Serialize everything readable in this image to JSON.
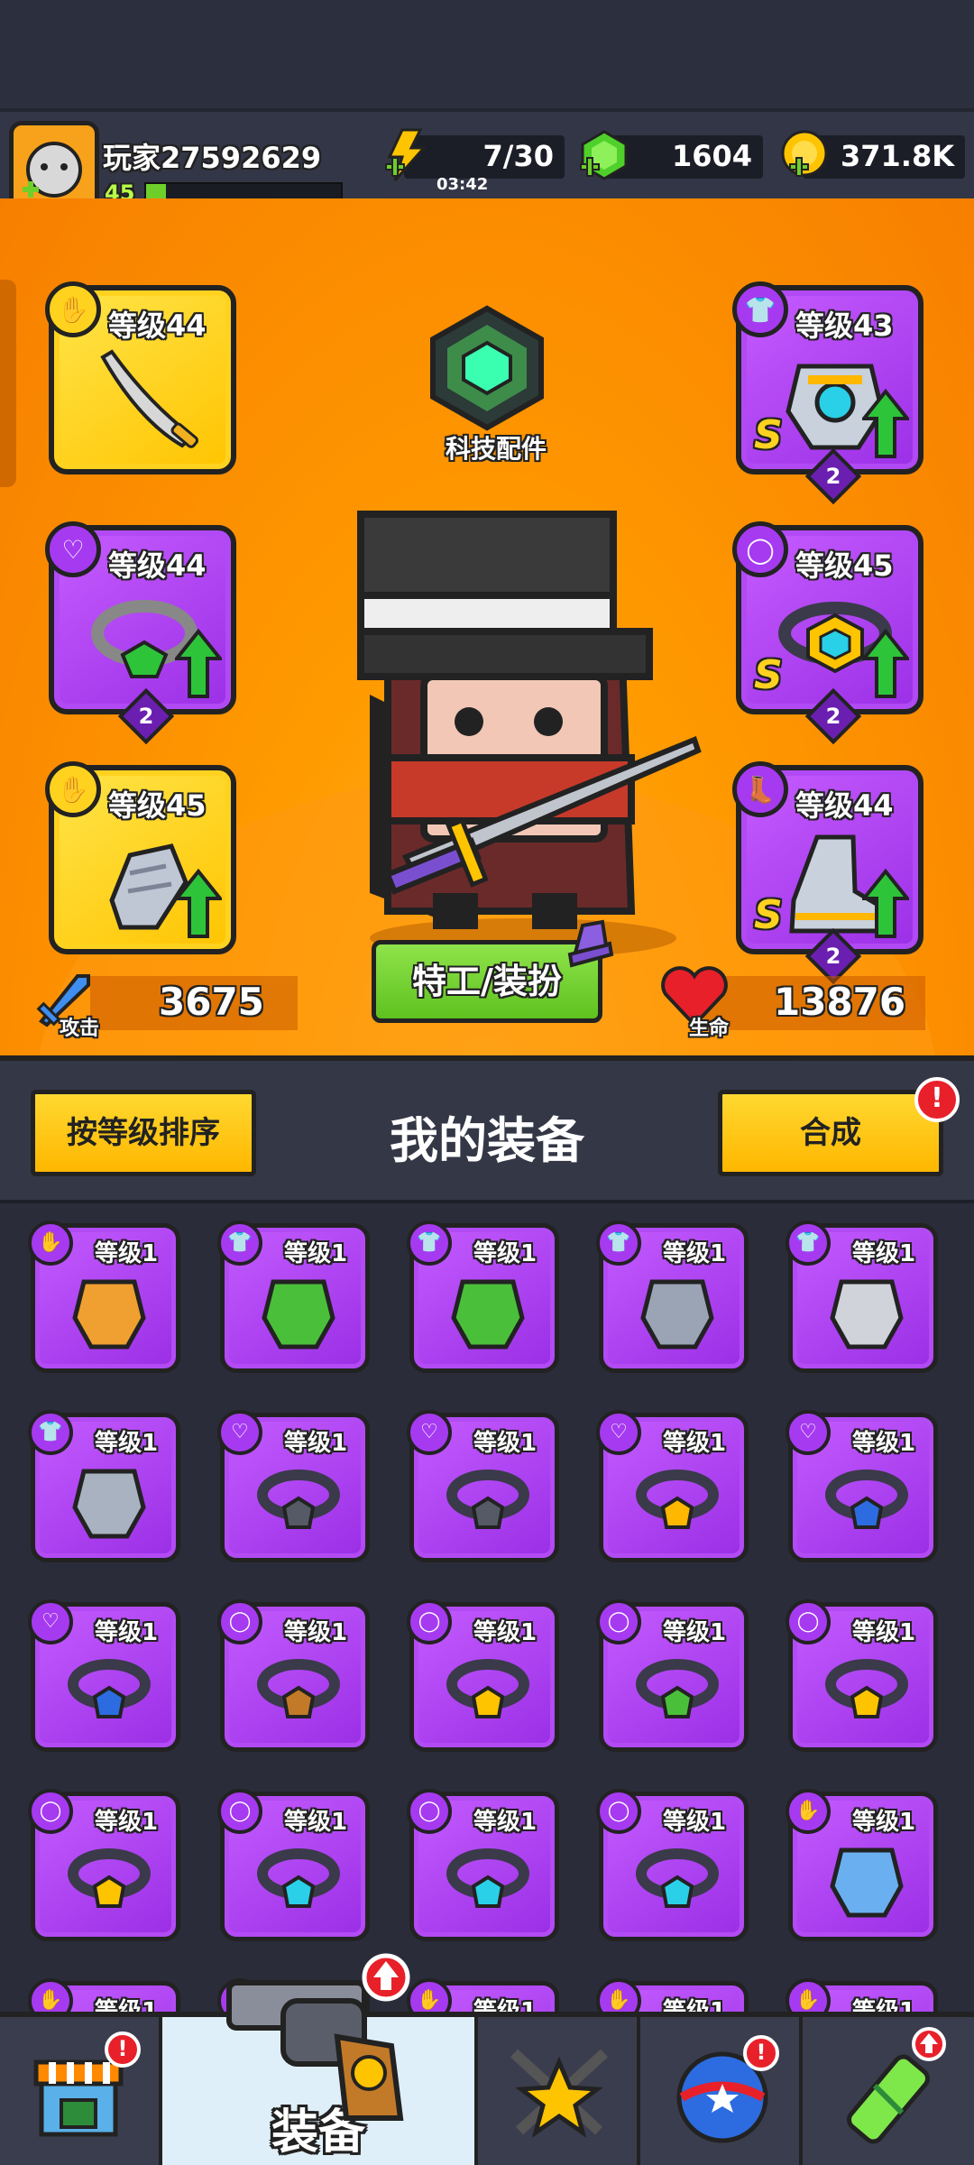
{
  "header": {
    "player_name": "玩家27592629",
    "player_level": "45",
    "xp_progress": 0.1,
    "energy": "7/30",
    "energy_timer": "03:42",
    "gems": "1604",
    "coins": "371.8K"
  },
  "hero": {
    "tech_part_label": "科技配件",
    "agent_button": "特工/装扮",
    "attack_label": "攻击",
    "attack_value": "3675",
    "hp_label": "生命",
    "hp_value": "13876",
    "slots": {
      "weapon": {
        "level": "等级44",
        "icon": "weapon-sword"
      },
      "necklace": {
        "level": "等级44",
        "icon": "necklace",
        "stars": "2"
      },
      "gloves": {
        "level": "等级45",
        "icon": "gloves"
      },
      "armor": {
        "level": "等级43",
        "icon": "armor",
        "stars": "2",
        "grade": "S"
      },
      "belt": {
        "level": "等级45",
        "icon": "belt",
        "stars": "2",
        "grade": "S"
      },
      "boots": {
        "level": "等级44",
        "icon": "boots",
        "stars": "2",
        "grade": "S"
      }
    }
  },
  "equipment": {
    "sort_button": "按等级排序",
    "title": "我的装备",
    "merge_button": "合成",
    "items": [
      {
        "level": "等级1",
        "type": "weapon",
        "art": "torch"
      },
      {
        "level": "等级1",
        "type": "armor",
        "art": "green-armor"
      },
      {
        "level": "等级1",
        "type": "armor",
        "art": "green-armor"
      },
      {
        "level": "等级1",
        "type": "armor",
        "art": "steel-armor"
      },
      {
        "level": "等级1",
        "type": "armor",
        "art": "vest"
      },
      {
        "level": "等级1",
        "type": "armor",
        "art": "chainmail"
      },
      {
        "level": "等级1",
        "type": "necklace",
        "art": "spike-collar"
      },
      {
        "level": "等级1",
        "type": "necklace",
        "art": "spike-collar"
      },
      {
        "level": "等级1",
        "type": "necklace",
        "art": "lantern-necklace"
      },
      {
        "level": "等级1",
        "type": "necklace",
        "art": "shield-necklace"
      },
      {
        "level": "等级1",
        "type": "necklace",
        "art": "shield-necklace"
      },
      {
        "level": "等级1",
        "type": "belt",
        "art": "cloth-belt"
      },
      {
        "level": "等级1",
        "type": "belt",
        "art": "star-belt"
      },
      {
        "level": "等级1",
        "type": "belt",
        "art": "gem-belt"
      },
      {
        "level": "等级1",
        "type": "belt",
        "art": "gold-belt"
      },
      {
        "level": "等级1",
        "type": "belt",
        "art": "gold-belt"
      },
      {
        "level": "等级1",
        "type": "belt",
        "art": "blue-belt"
      },
      {
        "level": "等级1",
        "type": "belt",
        "art": "blue-belt"
      },
      {
        "level": "等级1",
        "type": "belt",
        "art": "blue-belt"
      },
      {
        "level": "等级1",
        "type": "gloves",
        "art": "claw"
      },
      {
        "level": "等级1",
        "type": "gloves",
        "art": "partial"
      },
      {
        "level": "等级1",
        "type": "",
        "art": "partial"
      },
      {
        "level": "等级1",
        "type": "gloves",
        "art": "partial"
      },
      {
        "level": "等级1",
        "type": "gloves",
        "art": "partial"
      },
      {
        "level": "等级1",
        "type": "gloves",
        "art": "partial"
      }
    ]
  },
  "nav": {
    "tabs": [
      {
        "name": "shop",
        "icon": "shop-icon"
      },
      {
        "name": "equipment",
        "label": "装备",
        "icon": "revolver-icon",
        "active": true
      },
      {
        "name": "battle",
        "icon": "star-swords-icon"
      },
      {
        "name": "gacha",
        "icon": "ball-icon"
      },
      {
        "name": "dna",
        "icon": "dna-capsule-icon"
      }
    ]
  },
  "colors": {
    "orange_bg": "#ff9a00",
    "purple_slot": "#a63af0",
    "gold_slot": "#ffd21f",
    "green_button": "#6ecf2a",
    "yellow_button": "#ffc400",
    "alert_red": "#e8202a"
  }
}
